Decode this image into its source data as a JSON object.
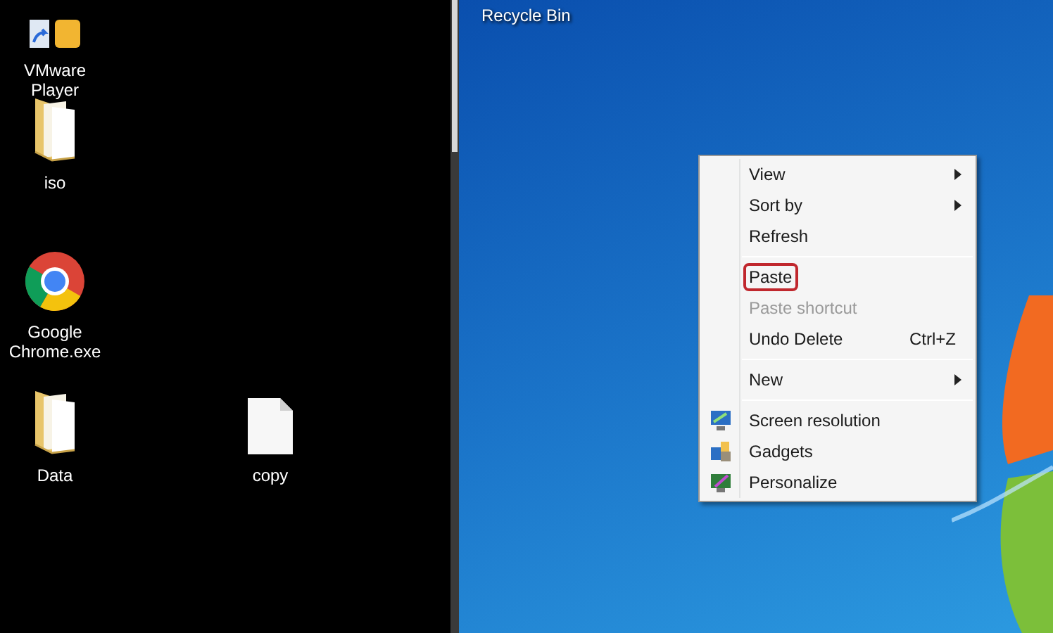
{
  "left_desktop": {
    "icons": [
      {
        "label": "VMware Player",
        "kind": "shortcut"
      },
      {
        "label": "iso",
        "kind": "folder"
      },
      {
        "label": "Google Chrome.exe",
        "kind": "browser"
      },
      {
        "label": "Data",
        "kind": "folder"
      },
      {
        "label": "copy",
        "kind": "file"
      }
    ]
  },
  "right_desktop": {
    "icons": [
      {
        "label": "Recycle Bin"
      }
    ],
    "context_menu": {
      "groups": [
        [
          {
            "label": "View",
            "kind": "submenu",
            "disabled": false,
            "highlighted": false
          },
          {
            "label": "Sort by",
            "kind": "submenu",
            "disabled": false,
            "highlighted": false
          },
          {
            "label": "Refresh",
            "kind": "command",
            "disabled": false,
            "highlighted": false
          }
        ],
        [
          {
            "label": "Paste",
            "kind": "command",
            "disabled": false,
            "highlighted": true
          },
          {
            "label": "Paste shortcut",
            "kind": "command",
            "disabled": true,
            "highlighted": false
          },
          {
            "label": "Undo Delete",
            "kind": "command",
            "disabled": false,
            "highlighted": false,
            "shortcut": "Ctrl+Z"
          }
        ],
        [
          {
            "label": "New",
            "kind": "submenu",
            "disabled": false,
            "highlighted": false
          }
        ],
        [
          {
            "label": "Screen resolution",
            "kind": "icon",
            "disabled": false,
            "highlighted": false
          },
          {
            "label": "Gadgets",
            "kind": "icon",
            "disabled": false,
            "highlighted": false
          },
          {
            "label": "Personalize",
            "kind": "icon",
            "disabled": false,
            "highlighted": false
          }
        ]
      ]
    }
  }
}
